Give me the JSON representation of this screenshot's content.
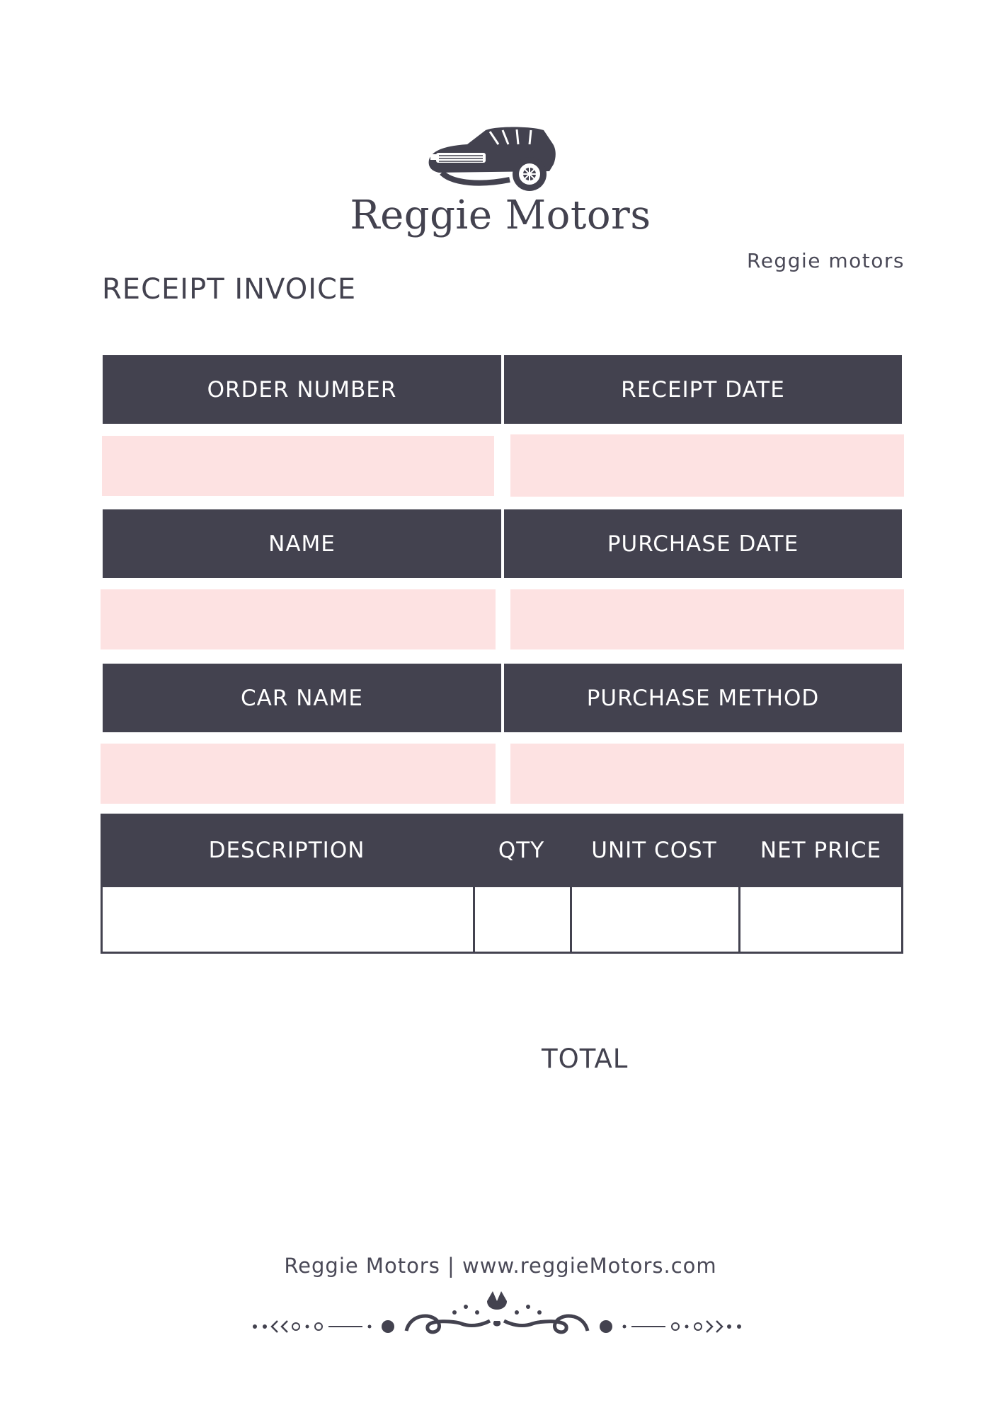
{
  "header": {
    "logo_icon": "car-icon",
    "brand_name": "Reggie Motors",
    "sub_brand": "Reggie  motors",
    "document_title": "RECEIPT INVOICE"
  },
  "fields": {
    "order_number": "ORDER NUMBER",
    "receipt_date": "RECEIPT DATE",
    "name": "NAME",
    "purchase_date": "PURCHASE DATE",
    "car_name": "CAR NAME",
    "purchase_method": "PURCHASE METHOD"
  },
  "items_table": {
    "columns": [
      "DESCRIPTION",
      "QTY",
      "UNIT COST",
      "NET PRICE"
    ]
  },
  "total_label": "TOTAL",
  "footer": {
    "text": "Reggie Motors | www.reggieMotors.com",
    "ornament_icon": "decorative-flourish-icon"
  },
  "colors": {
    "dark": "#43424f",
    "pink": "#fde2e2",
    "background": "#ffffff"
  }
}
